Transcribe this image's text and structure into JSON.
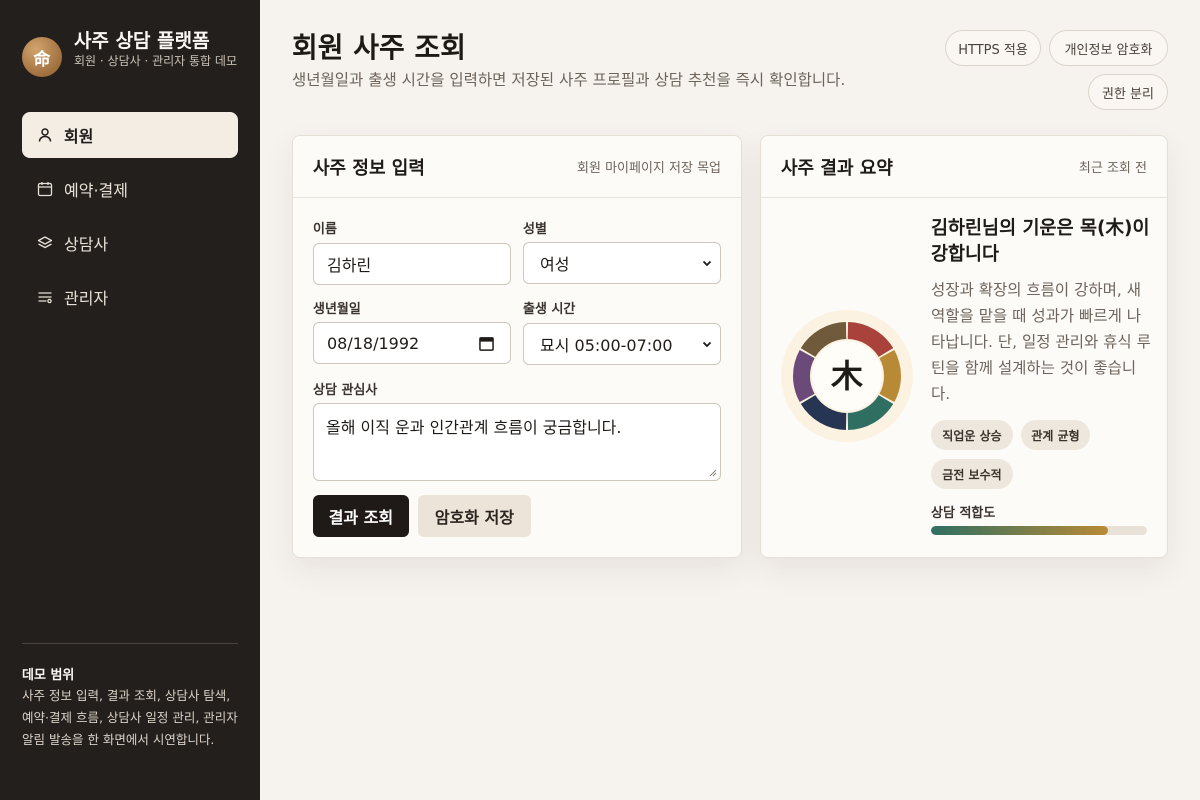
{
  "brand": {
    "logo_char": "命",
    "title": "사주 상담 플랫폼",
    "subtitle": "회원 · 상담사 · 관리자 통합 데모"
  },
  "nav": [
    {
      "label": "회원",
      "icon": "user-icon",
      "active": true
    },
    {
      "label": "예약·결제",
      "icon": "calendar-icon",
      "active": false
    },
    {
      "label": "상담사",
      "icon": "layers-icon",
      "active": false
    },
    {
      "label": "관리자",
      "icon": "list-settings-icon",
      "active": false
    }
  ],
  "demo": {
    "title": "데모 범위",
    "text": "사주 정보 입력, 결과 조회, 상담사 탐색, 예약·결제 흐름, 상담사 일정 관리, 관리자 알림 발송을 한 화면에서 시연합니다."
  },
  "header": {
    "title": "회원 사주 조회",
    "description": "생년월일과 출생 시간을 입력하면 저장된 사주 프로필과 상담 추천을 즉시 확인합니다.",
    "badges": [
      "HTTPS 적용",
      "개인정보 암호화",
      "권한 분리"
    ]
  },
  "form": {
    "title": "사주 정보 입력",
    "meta": "회원 마이페이지 저장 목업",
    "name_label": "이름",
    "name_value": "김하린",
    "gender_label": "성별",
    "gender_value": "여성",
    "birth_label": "생년월일",
    "birth_value": "08/18/1992",
    "time_label": "출생 시간",
    "time_value": "묘시 05:00-07:00",
    "interest_label": "상담 관심사",
    "interest_value": "올해 이직 운과 인간관계 흐름이 궁금합니다.",
    "submit_label": "결과 조회",
    "save_label": "암호화 저장"
  },
  "result": {
    "title": "사주 결과 요약",
    "meta": "최근 조회 전",
    "element_char": "木",
    "headline": "김하린님의 기운은 목(木)이 강합니다",
    "description": "성장과 확장의 흐름이 강하며, 새 역할을 맡을 때 성과가 빠르게 나타납니다. 단, 일정 관리와 휴식 루틴을 함께 설계하는 것이 좋습니다.",
    "tags": [
      "직업운 상승",
      "관계 균형",
      "금전 보수적"
    ],
    "fit_label": "상담 적합도",
    "fit_value": 0.82,
    "wheel_colors": [
      "#a8423a",
      "#b98a36",
      "#2f6f62",
      "#263552",
      "#6a4a78",
      "#6f5a3b"
    ]
  }
}
